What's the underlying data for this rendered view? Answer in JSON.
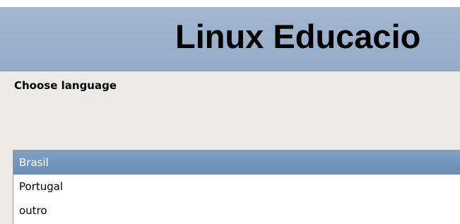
{
  "banner": {
    "title": "Linux Educacio"
  },
  "prompt": {
    "label": "Choose language"
  },
  "language_list": {
    "selected_index": 0,
    "items": [
      {
        "label": "Brasil"
      },
      {
        "label": "Portugal"
      },
      {
        "label": "outro"
      }
    ]
  },
  "colors": {
    "banner": "#9bb1cd",
    "selection": "#7496bd",
    "background": "#edebe7"
  }
}
